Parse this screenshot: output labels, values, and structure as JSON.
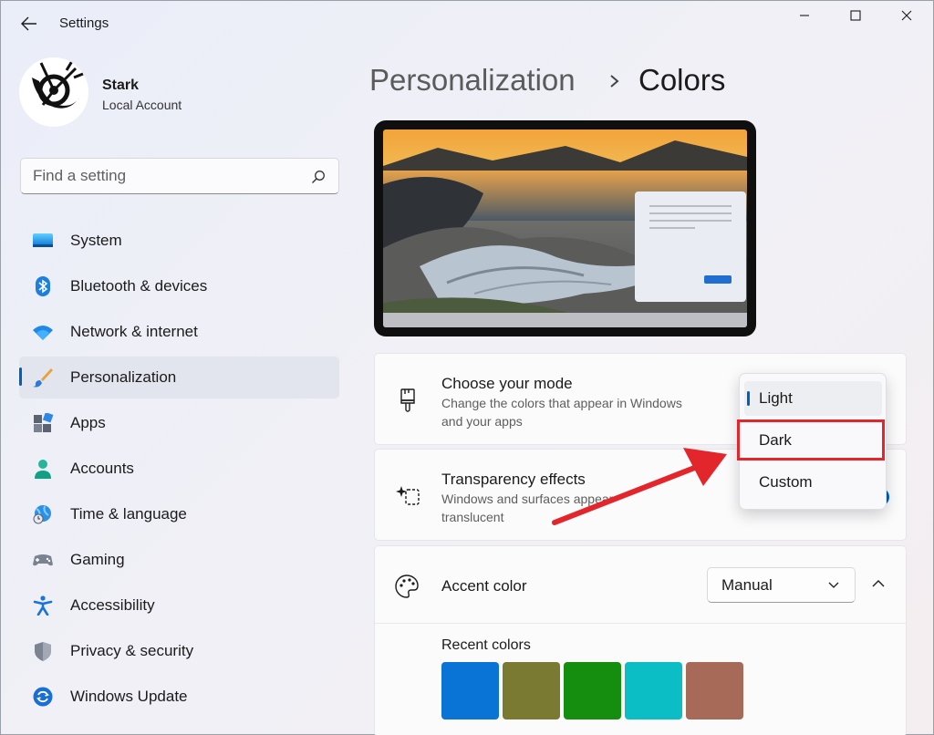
{
  "window": {
    "title": "Settings"
  },
  "profile": {
    "name": "Stark",
    "account_type": "Local Account"
  },
  "search": {
    "placeholder": "Find a setting"
  },
  "sidebar": {
    "items": [
      {
        "label": "System",
        "icon": "system-icon"
      },
      {
        "label": "Bluetooth & devices",
        "icon": "bluetooth-icon"
      },
      {
        "label": "Network & internet",
        "icon": "wifi-icon"
      },
      {
        "label": "Personalization",
        "icon": "brush-icon",
        "selected": true
      },
      {
        "label": "Apps",
        "icon": "apps-icon"
      },
      {
        "label": "Accounts",
        "icon": "person-icon"
      },
      {
        "label": "Time & language",
        "icon": "globe-clock-icon"
      },
      {
        "label": "Gaming",
        "icon": "gamepad-icon"
      },
      {
        "label": "Accessibility",
        "icon": "accessibility-icon"
      },
      {
        "label": "Privacy & security",
        "icon": "shield-icon"
      },
      {
        "label": "Windows Update",
        "icon": "update-icon"
      }
    ]
  },
  "header": {
    "parent": "Personalization",
    "current": "Colors"
  },
  "mode_card": {
    "title": "Choose your mode",
    "description_line1": "Change the colors that appear in Windows",
    "description_line2": "and your apps"
  },
  "transparency_card": {
    "title": "Transparency effects",
    "description_line1": "Windows and surfaces appear",
    "description_line2": "translucent"
  },
  "mode_menu": {
    "options": [
      "Light",
      "Dark",
      "Custom"
    ],
    "selected": "Light",
    "highlighted": "Dark"
  },
  "accent_card": {
    "title": "Accent color",
    "select_value": "Manual",
    "recent_colors_label": "Recent colors",
    "recent_colors": [
      "#0a74d6",
      "#7a7a33",
      "#158d0f",
      "#0bbec6",
      "#a86a58"
    ]
  },
  "colors": {
    "accent": "#005fb8",
    "annotation_red": "#e3262b"
  }
}
